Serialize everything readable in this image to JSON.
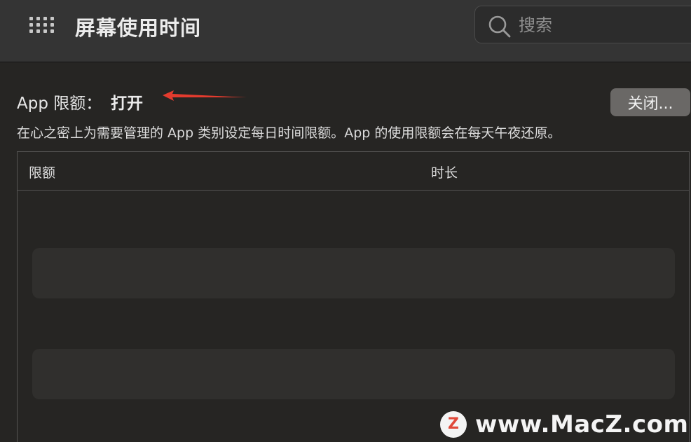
{
  "header": {
    "title": "屏幕使用时间",
    "search_placeholder": "搜索"
  },
  "limits": {
    "label": "App 限额：",
    "status": "打开",
    "close_button": "关闭...",
    "description": "在心之密上为需要管理的 App 类别设定每日时间限额。App 的使用限额会在每天午夜还原。"
  },
  "table": {
    "columns": [
      "限额",
      "时长"
    ]
  },
  "watermark": {
    "logo_letter": "Z",
    "text": "www.MacZ.com"
  },
  "colors": {
    "annotation_arrow": "#e33b2e",
    "background": "#262523",
    "toolbar": "#343434",
    "button": "#6a6866"
  },
  "icons": {
    "app_grid": "grid-icon",
    "search": "search-icon"
  }
}
